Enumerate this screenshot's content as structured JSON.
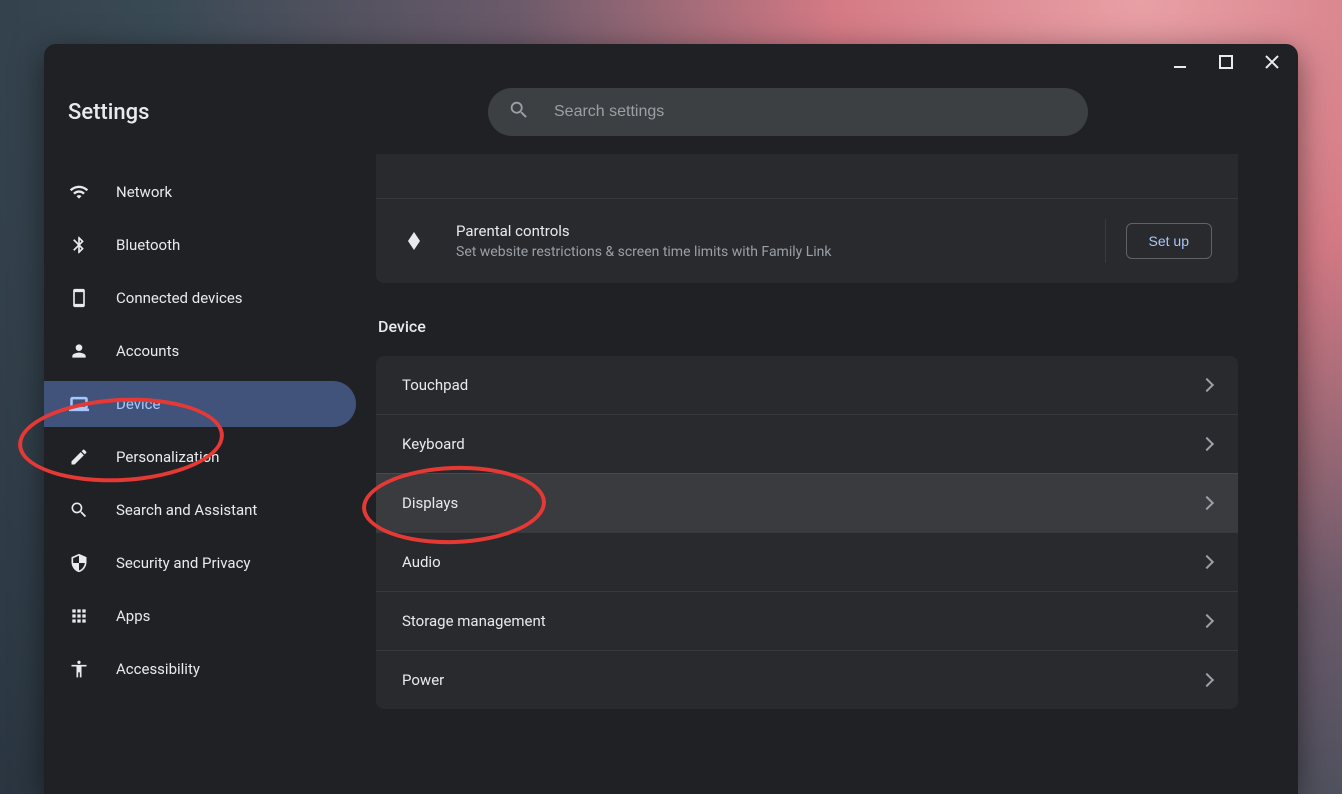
{
  "app_title": "Settings",
  "search": {
    "placeholder": "Search settings"
  },
  "sidebar": {
    "items": [
      {
        "label": "Network"
      },
      {
        "label": "Bluetooth"
      },
      {
        "label": "Connected devices"
      },
      {
        "label": "Accounts"
      },
      {
        "label": "Device"
      },
      {
        "label": "Personalization"
      },
      {
        "label": "Search and Assistant"
      },
      {
        "label": "Security and Privacy"
      },
      {
        "label": "Apps"
      },
      {
        "label": "Accessibility"
      }
    ]
  },
  "parental": {
    "title": "Parental controls",
    "sub": "Set website restrictions & screen time limits with Family Link",
    "button": "Set up"
  },
  "device_section": {
    "heading": "Device",
    "rows": [
      {
        "label": "Touchpad"
      },
      {
        "label": "Keyboard"
      },
      {
        "label": "Displays"
      },
      {
        "label": "Audio"
      },
      {
        "label": "Storage management"
      },
      {
        "label": "Power"
      }
    ]
  }
}
